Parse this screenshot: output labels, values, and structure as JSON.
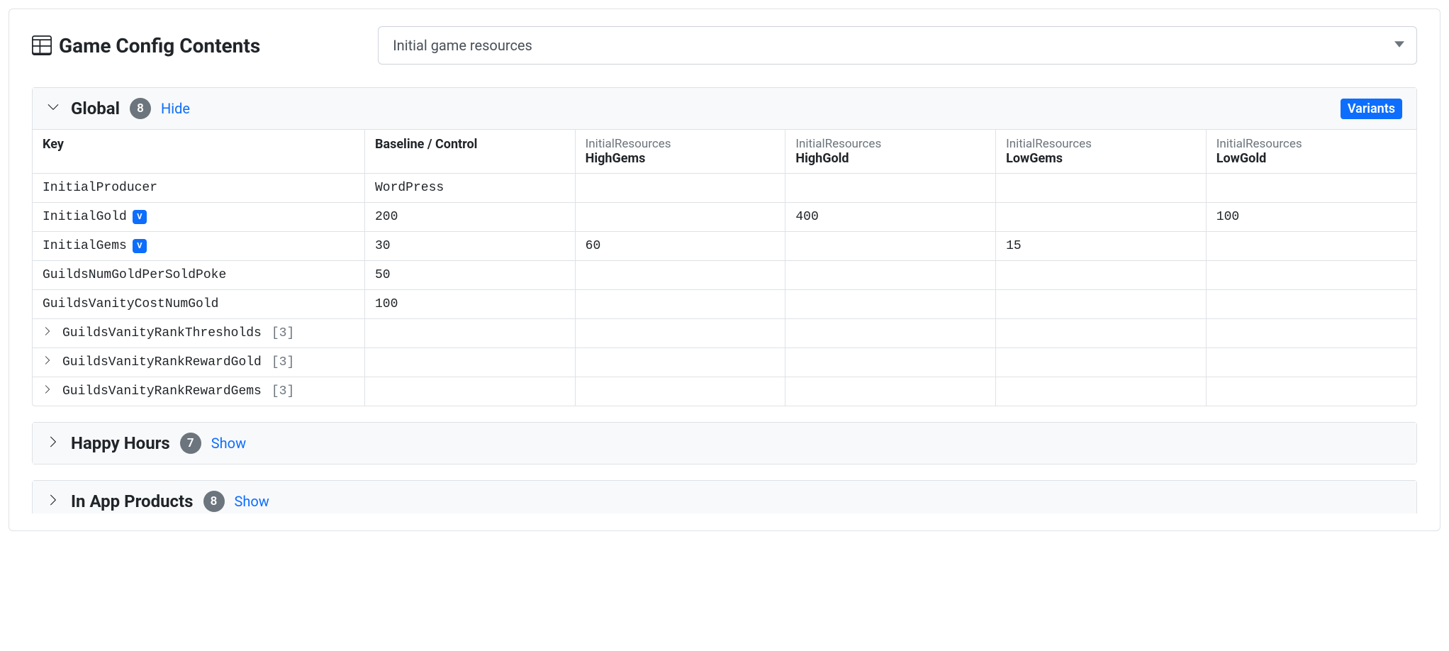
{
  "header": {
    "title": "Game Config Contents",
    "select_value": "Initial game resources"
  },
  "variants_label": "Variants",
  "sections": {
    "global": {
      "title": "Global",
      "count": "8",
      "toggle": "Hide",
      "columns": {
        "key": "Key",
        "baseline": "Baseline / Control",
        "variant_prefix": "InitialResources",
        "variants": [
          "HighGems",
          "HighGold",
          "LowGems",
          "LowGold"
        ]
      },
      "rows": [
        {
          "key": "InitialProducer",
          "variant": false,
          "expandable": false,
          "bracket": "",
          "baseline": "WordPress",
          "v": [
            "",
            "",
            "",
            ""
          ]
        },
        {
          "key": "InitialGold",
          "variant": true,
          "expandable": false,
          "bracket": "",
          "baseline": "200",
          "v": [
            "",
            "400",
            "",
            "100"
          ]
        },
        {
          "key": "InitialGems",
          "variant": true,
          "expandable": false,
          "bracket": "",
          "baseline": "30",
          "v": [
            "60",
            "",
            "15",
            ""
          ]
        },
        {
          "key": "GuildsNumGoldPerSoldPoke",
          "variant": false,
          "expandable": false,
          "bracket": "",
          "baseline": "50",
          "v": [
            "",
            "",
            "",
            ""
          ]
        },
        {
          "key": "GuildsVanityCostNumGold",
          "variant": false,
          "expandable": false,
          "bracket": "",
          "baseline": "100",
          "v": [
            "",
            "",
            "",
            ""
          ]
        },
        {
          "key": "GuildsVanityRankThresholds",
          "variant": false,
          "expandable": true,
          "bracket": "[3]",
          "baseline": "",
          "v": [
            "",
            "",
            "",
            ""
          ]
        },
        {
          "key": "GuildsVanityRankRewardGold",
          "variant": false,
          "expandable": true,
          "bracket": "[3]",
          "baseline": "",
          "v": [
            "",
            "",
            "",
            ""
          ]
        },
        {
          "key": "GuildsVanityRankRewardGems",
          "variant": false,
          "expandable": true,
          "bracket": "[3]",
          "baseline": "",
          "v": [
            "",
            "",
            "",
            ""
          ]
        }
      ]
    },
    "happy": {
      "title": "Happy Hours",
      "count": "7",
      "toggle": "Show"
    },
    "iap": {
      "title": "In App Products",
      "count": "8",
      "toggle": "Show"
    }
  }
}
